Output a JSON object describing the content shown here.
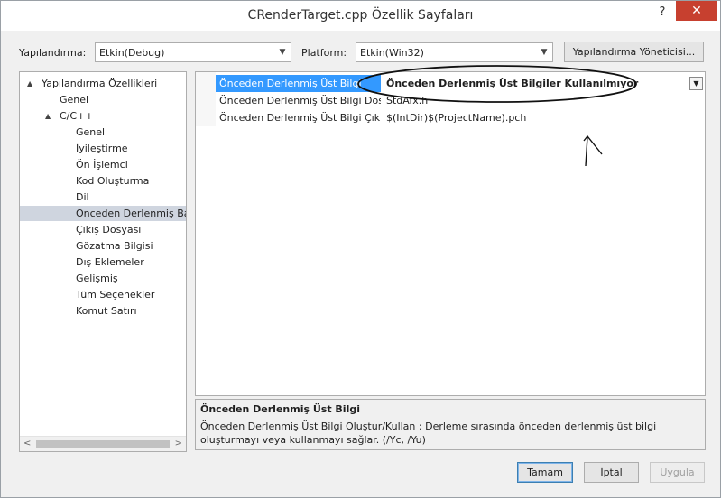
{
  "window": {
    "title": "CRenderTarget.cpp Özellik Sayfaları",
    "help_glyph": "?",
    "close_glyph": "✕"
  },
  "toolbar": {
    "configuration_label": "Yapılandırma:",
    "configuration_value": "Etkin(Debug)",
    "platform_label": "Platform:",
    "platform_value": "Etkin(Win32)",
    "config_manager_label": "Yapılandırma Yöneticisi..."
  },
  "tree": {
    "items": [
      {
        "label": "Yapılandırma Özellikleri",
        "expanded": true
      },
      {
        "label": "Genel"
      },
      {
        "label": "C/C++",
        "expanded": true
      },
      {
        "label": "Genel"
      },
      {
        "label": "İyileştirme"
      },
      {
        "label": "Ön İşlemci"
      },
      {
        "label": "Kod Oluşturma"
      },
      {
        "label": "Dil"
      },
      {
        "label": "Önceden Derlenmiş Ba",
        "selected": true
      },
      {
        "label": "Çıkış Dosyası"
      },
      {
        "label": "Gözatma Bilgisi"
      },
      {
        "label": "Dış Eklemeler"
      },
      {
        "label": "Gelişmiş"
      },
      {
        "label": "Tüm Seçenekler"
      },
      {
        "label": "Komut Satırı"
      }
    ]
  },
  "properties": {
    "rows": [
      {
        "name": "Önceden Derlenmiş Üst Bilgi",
        "value": "Önceden Derlenmiş Üst Bilgiler Kullanılmıyor",
        "selected": true
      },
      {
        "name": "Önceden Derlenmiş Üst Bilgi Dosy",
        "value": "StdAfx.h"
      },
      {
        "name": "Önceden Derlenmiş Üst Bilgi Çıkış",
        "value": "$(IntDir)$(ProjectName).pch"
      }
    ]
  },
  "description": {
    "title": "Önceden Derlenmiş Üst Bilgi",
    "body": "Önceden Derlenmiş Üst Bilgi Oluştur/Kullan : Derleme sırasında önceden derlenmiş üst bilgi oluşturmayı veya kullanmayı sağlar.     (/Yc, /Yu)"
  },
  "buttons": {
    "ok": "Tamam",
    "cancel": "İptal",
    "apply": "Uygula"
  },
  "icons": {
    "expand": "▲",
    "dropdown": "▼",
    "scroll_left": "<",
    "scroll_right": ">"
  }
}
